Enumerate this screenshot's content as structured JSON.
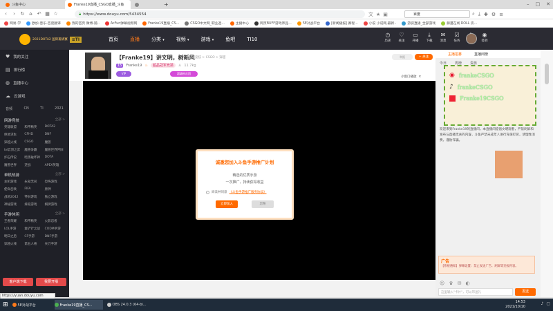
{
  "browser": {
    "tabs": [
      {
        "label": "斗鱼中心",
        "color": "#ff6a00"
      },
      {
        "label": "Franke19直播_CSGO直播_斗鱼",
        "color": "#ff6a00",
        "active": true
      },
      {
        "label": "",
        "color": "#888"
      }
    ],
    "new_tab": "+",
    "url": "https://www.douyu.com/5434554",
    "search_placeholder": "百度",
    "bookmarks": [
      "网易-学",
      "欧加-音乐-百度翻译",
      "我的首页 微博-随..",
      "AcFun弹幕视频网",
      "Franke19直播_CS...",
      "CSGO中文网_职业选...",
      "主播中心",
      "网页BUFF游戏饰品...",
      "5E对战平台",
      "[新闻播报] 赛程...",
      "小说 小说网,最新..",
      "游侠直播_全部游戏",
      "藤蔓在线 ROLL 房..."
    ]
  },
  "site": {
    "badge": "2021DOTA2 国际邀请赛",
    "nav": [
      "首页",
      "直播",
      "分类",
      "视频",
      "游戏",
      "鱼吧",
      "TI10"
    ],
    "header_icons": [
      "历史",
      "关注",
      "开播",
      "下载",
      "消息",
      "任务",
      "福利",
      "签到"
    ]
  },
  "sidebar": {
    "top_items": [
      "我的关注",
      "排行榜",
      "直播中心",
      "云游戏"
    ],
    "tags": [
      "音频",
      "CN",
      "TI",
      "2021"
    ],
    "sections": [
      {
        "title": "网游竞技",
        "more": "全部 >",
        "items": [
          "英雄联盟",
          "和平精英",
          "DOTA2",
          "绝地求生",
          "CFHD",
          "DNF",
          "穿越火线",
          "CSGO",
          "魔兽",
          "lol云顶之弈",
          "魔兽争霸",
          "魔兽世界怀旧",
          "炉石传说",
          "暗黑破坏神",
          "DOTA",
          "魔兽世界",
          "逆战",
          "APEX英雄"
        ]
      },
      {
        "title": "单机热游",
        "more": "全部 >",
        "items": [
          "主机游戏",
          "永劫无间",
          "恐怖游戏",
          "使命召唤",
          "FIFA",
          "原神",
          "战地2042",
          "怀旧游戏",
          "独立游戏",
          "神秘游戏",
          "摔跤游戏",
          "棋牌游戏"
        ]
      },
      {
        "title": "手游休闲",
        "more": "全部 >",
        "items": [
          "王者荣耀",
          "和平精英",
          "火影忍者",
          "LOL手游",
          "金铲铲之战",
          "CODM手游",
          "明日之后",
          "CF手游",
          "DNF手游",
          "穿越火线",
          "第五人格",
          "天刀手游"
        ]
      }
    ],
    "buttons": [
      "客户端下载",
      "我要开播"
    ]
  },
  "stream": {
    "title": "【Franke19】讲文明，树新风",
    "category": "网游竞技 > CSGO > 穿越",
    "level_tag": "15",
    "streamer": "Franke19",
    "hot_badge": "超品冠军竞猜",
    "fans": "11.7kg",
    "report": "举报",
    "follow": "+ 关注",
    "vip_btn": "超级粉丝团",
    "mini_label": "小窗口播放",
    "close_label": "✕"
  },
  "dialog": {
    "title": "诚邀您加入斗鱼手游推广计划",
    "sub1": "精选的优质手游",
    "sub2": "一次推广，持续获得收益",
    "agree_prefix": "阅读并同意",
    "agree_link": "《斗鱼手游推广服务协议》",
    "join": "立即加入",
    "cancel": "忽略"
  },
  "right": {
    "tabs": [
      "主播招募",
      "直播间榜"
    ],
    "subtabs": [
      "今日",
      "周榜",
      "贵族"
    ],
    "socials": [
      "frankeCSGO",
      "frankeCSGO",
      "Franke19CSGO"
    ],
    "chat_text": "欢迎来到Franke19的直播间，本直播间提倡文明观看，严禁刷屏和发布与直播无关的内容，斗鱼严禁未成年人进行充值打赏，请理性消费，谨防诈骗。",
    "ad_label": "广告",
    "ad_text": "【系统通知】弹幕设置：禁止发送广告、刷屏等违规内容。",
    "input_placeholder": "这里输入\"卡片\"，可以带送礼",
    "send": "发送"
  },
  "taskbar": {
    "items": [
      "5E对战平台",
      "Franke19直播_CS...",
      "OBS 24.0.3 (64-bi..."
    ],
    "time": "14:53",
    "date": "2021/10/10"
  },
  "status_url": "https://yuan.douyu.com"
}
